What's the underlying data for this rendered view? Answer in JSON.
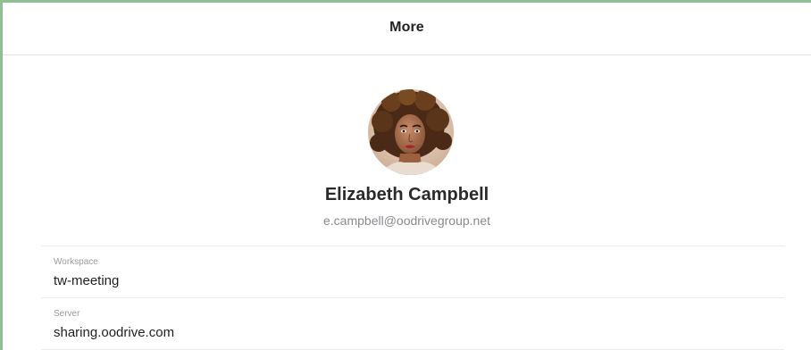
{
  "header": {
    "title": "More"
  },
  "profile": {
    "name": "Elizabeth Campbell",
    "email": "e.campbell@oodrivegroup.net"
  },
  "details": [
    {
      "label": "Workspace",
      "value": "tw-meeting"
    },
    {
      "label": "Server",
      "value": "sharing.oodrive.com"
    }
  ],
  "colors": {
    "frame_border": "#8fbf95",
    "separator": "#ececee",
    "secondary_text": "#8a8a8e"
  }
}
